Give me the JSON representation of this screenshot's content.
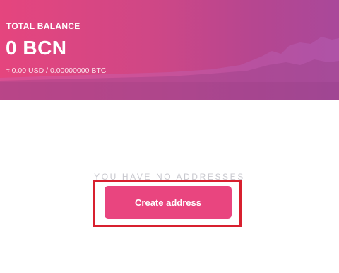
{
  "balance": {
    "label": "TOTAL BALANCE",
    "amount": "0 BCN",
    "fiat_btc": "≈ 0.00 USD / 0.00000000 BTC"
  },
  "addresses": {
    "empty_message": "YOU HAVE NO ADDRESSES",
    "create_button_label": "Create address"
  },
  "colors": {
    "header_gradient_start": "#e5457e",
    "header_gradient_end": "#a9489a",
    "button": "#e9457f",
    "highlight_border": "#d8202f"
  }
}
